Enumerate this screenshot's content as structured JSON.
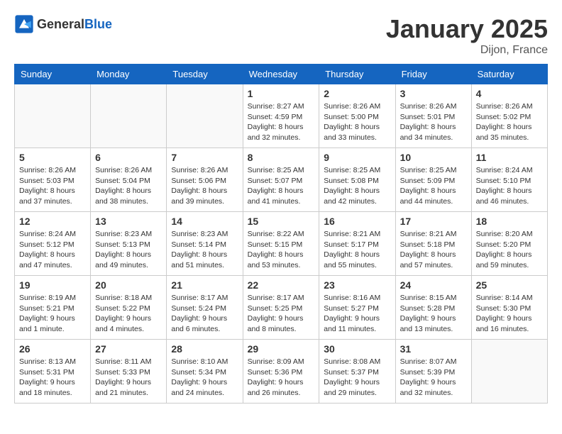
{
  "header": {
    "logo_general": "General",
    "logo_blue": "Blue",
    "month": "January 2025",
    "location": "Dijon, France"
  },
  "weekdays": [
    "Sunday",
    "Monday",
    "Tuesday",
    "Wednesday",
    "Thursday",
    "Friday",
    "Saturday"
  ],
  "weeks": [
    [
      {
        "day": "",
        "info": ""
      },
      {
        "day": "",
        "info": ""
      },
      {
        "day": "",
        "info": ""
      },
      {
        "day": "1",
        "info": "Sunrise: 8:27 AM\nSunset: 4:59 PM\nDaylight: 8 hours and 32 minutes."
      },
      {
        "day": "2",
        "info": "Sunrise: 8:26 AM\nSunset: 5:00 PM\nDaylight: 8 hours and 33 minutes."
      },
      {
        "day": "3",
        "info": "Sunrise: 8:26 AM\nSunset: 5:01 PM\nDaylight: 8 hours and 34 minutes."
      },
      {
        "day": "4",
        "info": "Sunrise: 8:26 AM\nSunset: 5:02 PM\nDaylight: 8 hours and 35 minutes."
      }
    ],
    [
      {
        "day": "5",
        "info": "Sunrise: 8:26 AM\nSunset: 5:03 PM\nDaylight: 8 hours and 37 minutes."
      },
      {
        "day": "6",
        "info": "Sunrise: 8:26 AM\nSunset: 5:04 PM\nDaylight: 8 hours and 38 minutes."
      },
      {
        "day": "7",
        "info": "Sunrise: 8:26 AM\nSunset: 5:06 PM\nDaylight: 8 hours and 39 minutes."
      },
      {
        "day": "8",
        "info": "Sunrise: 8:25 AM\nSunset: 5:07 PM\nDaylight: 8 hours and 41 minutes."
      },
      {
        "day": "9",
        "info": "Sunrise: 8:25 AM\nSunset: 5:08 PM\nDaylight: 8 hours and 42 minutes."
      },
      {
        "day": "10",
        "info": "Sunrise: 8:25 AM\nSunset: 5:09 PM\nDaylight: 8 hours and 44 minutes."
      },
      {
        "day": "11",
        "info": "Sunrise: 8:24 AM\nSunset: 5:10 PM\nDaylight: 8 hours and 46 minutes."
      }
    ],
    [
      {
        "day": "12",
        "info": "Sunrise: 8:24 AM\nSunset: 5:12 PM\nDaylight: 8 hours and 47 minutes."
      },
      {
        "day": "13",
        "info": "Sunrise: 8:23 AM\nSunset: 5:13 PM\nDaylight: 8 hours and 49 minutes."
      },
      {
        "day": "14",
        "info": "Sunrise: 8:23 AM\nSunset: 5:14 PM\nDaylight: 8 hours and 51 minutes."
      },
      {
        "day": "15",
        "info": "Sunrise: 8:22 AM\nSunset: 5:15 PM\nDaylight: 8 hours and 53 minutes."
      },
      {
        "day": "16",
        "info": "Sunrise: 8:21 AM\nSunset: 5:17 PM\nDaylight: 8 hours and 55 minutes."
      },
      {
        "day": "17",
        "info": "Sunrise: 8:21 AM\nSunset: 5:18 PM\nDaylight: 8 hours and 57 minutes."
      },
      {
        "day": "18",
        "info": "Sunrise: 8:20 AM\nSunset: 5:20 PM\nDaylight: 8 hours and 59 minutes."
      }
    ],
    [
      {
        "day": "19",
        "info": "Sunrise: 8:19 AM\nSunset: 5:21 PM\nDaylight: 9 hours and 1 minute."
      },
      {
        "day": "20",
        "info": "Sunrise: 8:18 AM\nSunset: 5:22 PM\nDaylight: 9 hours and 4 minutes."
      },
      {
        "day": "21",
        "info": "Sunrise: 8:17 AM\nSunset: 5:24 PM\nDaylight: 9 hours and 6 minutes."
      },
      {
        "day": "22",
        "info": "Sunrise: 8:17 AM\nSunset: 5:25 PM\nDaylight: 9 hours and 8 minutes."
      },
      {
        "day": "23",
        "info": "Sunrise: 8:16 AM\nSunset: 5:27 PM\nDaylight: 9 hours and 11 minutes."
      },
      {
        "day": "24",
        "info": "Sunrise: 8:15 AM\nSunset: 5:28 PM\nDaylight: 9 hours and 13 minutes."
      },
      {
        "day": "25",
        "info": "Sunrise: 8:14 AM\nSunset: 5:30 PM\nDaylight: 9 hours and 16 minutes."
      }
    ],
    [
      {
        "day": "26",
        "info": "Sunrise: 8:13 AM\nSunset: 5:31 PM\nDaylight: 9 hours and 18 minutes."
      },
      {
        "day": "27",
        "info": "Sunrise: 8:11 AM\nSunset: 5:33 PM\nDaylight: 9 hours and 21 minutes."
      },
      {
        "day": "28",
        "info": "Sunrise: 8:10 AM\nSunset: 5:34 PM\nDaylight: 9 hours and 24 minutes."
      },
      {
        "day": "29",
        "info": "Sunrise: 8:09 AM\nSunset: 5:36 PM\nDaylight: 9 hours and 26 minutes."
      },
      {
        "day": "30",
        "info": "Sunrise: 8:08 AM\nSunset: 5:37 PM\nDaylight: 9 hours and 29 minutes."
      },
      {
        "day": "31",
        "info": "Sunrise: 8:07 AM\nSunset: 5:39 PM\nDaylight: 9 hours and 32 minutes."
      },
      {
        "day": "",
        "info": ""
      }
    ]
  ]
}
